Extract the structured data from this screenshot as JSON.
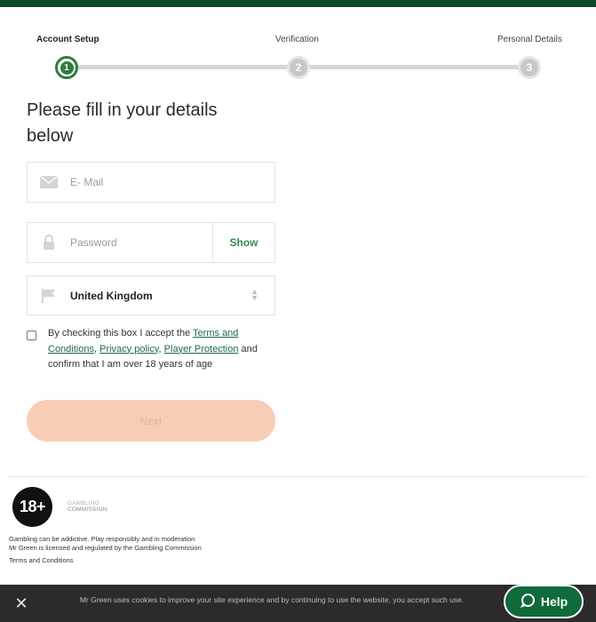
{
  "stepper": {
    "steps": [
      {
        "label": "Account Setup",
        "number": "1",
        "state": "active"
      },
      {
        "label": "Verification",
        "number": "2",
        "state": "inactive"
      },
      {
        "label": "Personal Details",
        "number": "3",
        "state": "inactive"
      }
    ]
  },
  "form": {
    "heading": "Please fill in your details below",
    "email": {
      "placeholder": "E- Mail",
      "icon": "envelope-icon"
    },
    "password": {
      "placeholder": "Password",
      "icon": "lock-icon",
      "show_label": "Show"
    },
    "country": {
      "value": "United Kingdom",
      "icon": "flag-icon"
    },
    "terms": {
      "prefix": "By checking this box I accept the ",
      "link1": "Terms and Conditions",
      "sep1": ", ",
      "link2": "Privacy policy",
      "sep2": ", ",
      "link3": "Player Protection",
      "suffix": " and confirm that I am over 18 years of age"
    },
    "next_label": "Next"
  },
  "footer": {
    "age_badge": "18+",
    "logo_line1": "GAMBLING",
    "logo_line2": "COMMISSION",
    "line1": "Gambling can be addictive. Play responsibly and in moderation",
    "line2": "Mr Green is licensed and regulated by the Gambling Commission",
    "terms_link": "Terms and Conditions"
  },
  "cookie": {
    "text": "Mr Green uses cookies to improve your site experience and by continuing to use the website, you accept such use.",
    "close_icon": "close-icon"
  },
  "help": {
    "label": "Help",
    "icon": "chat-bubble-icon"
  },
  "colors": {
    "brand": "#0b4a2e",
    "accent": "#2e7d3e",
    "next_disabled": "#f7cdb6",
    "help": "#0f6b3a"
  }
}
